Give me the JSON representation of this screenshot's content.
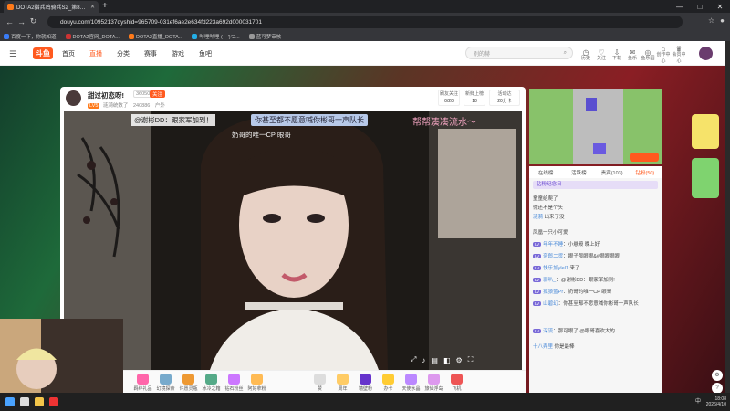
{
  "browser": {
    "tab_title": "DOTA2指兵鸡骑兵S2_第8…",
    "url": "douyu.com/10952137dyshid=965709-031ef6ae2e634fd223a692d000031701",
    "bookmarks": [
      "百度一下，你就知道",
      "DOTA2官网_DOTA...",
      "DOTA2直播_DOTA...",
      "哔哩哔哩 ( '- ')つ...",
      "蓝可梦审核"
    ]
  },
  "site": {
    "logo": "斗鱼",
    "nav": [
      "首页",
      "直播",
      "分类",
      "赛事",
      "游戏",
      "鱼吧"
    ],
    "search_placeholder": "别的赫",
    "header_icons": [
      "历史",
      "关注",
      "下载",
      "鱼乐",
      "鱼乐园",
      "创作中心",
      "会员中心"
    ]
  },
  "host": {
    "name": "甜过初恋呀!",
    "room_id": "36050",
    "follow": "关注",
    "level": "LV5",
    "sub": "涟漪统数了",
    "fans": "240886",
    "area": "户外",
    "stats": [
      {
        "label": "刷友关注",
        "value": "0/20"
      },
      {
        "label": "新鲜上榜",
        "value": "18"
      },
      {
        "label": "活动达",
        "value": "20分卡"
      }
    ]
  },
  "overlay": {
    "caption_left": "@谢彬DD：跟家军加到！",
    "caption_mid": "你甚至都不愿意喊你彬哥一声队长",
    "caption_right": "帮帮凑凑流水～",
    "caption_sub": "奶哥的唯一CP 眼哥"
  },
  "gifts": [
    "羁绊礼品",
    "幻境探索",
    "许愿灵瓶",
    "冰冷之箱",
    "钻石粉丝",
    "阿好拿粉",
    "赞",
    "周年",
    "墙壁粉",
    "办卡",
    "天使水晶",
    "旅仙浮岛",
    "飞机"
  ],
  "chat": {
    "tabs": [
      "在线榜",
      "活跃榜",
      "贵宾(103)",
      "钻粉(50)"
    ],
    "pin": "钻粉纪念日",
    "rows": [
      {
        "user": "",
        "text": "童童给爬了"
      },
      {
        "user": "",
        "text": "你还不是个头"
      },
      {
        "user": "涟漪",
        "text": "出来了没"
      },
      {
        "user": "",
        "text": "凤凰一只小可爱"
      },
      {
        "user": "年年不睡",
        "text": "小悬殿 晚上好"
      },
      {
        "user": "奈郎二货",
        "text": "眼子那眼眼&#眼眼眼眼"
      },
      {
        "user": "快乐加ylel1",
        "text": "来了"
      },
      {
        "user": "弱叭_",
        "text": "@谢彬DD：跟家军加到!"
      },
      {
        "user": "孤狼蓝Pr",
        "text": "奶哥的唯一CP 眼哥"
      },
      {
        "user": "山碧幻",
        "text": "你甚至都不愿意喊你彬哥一声队长"
      },
      {
        "user": "深流",
        "text": "那可眼了 @眼哥喜欢大的"
      },
      {
        "user": "十八弄里",
        "text": "你是最棒"
      }
    ]
  },
  "clock": {
    "time": "18:08",
    "date": "2026/4/10"
  },
  "tray_lang": "中"
}
